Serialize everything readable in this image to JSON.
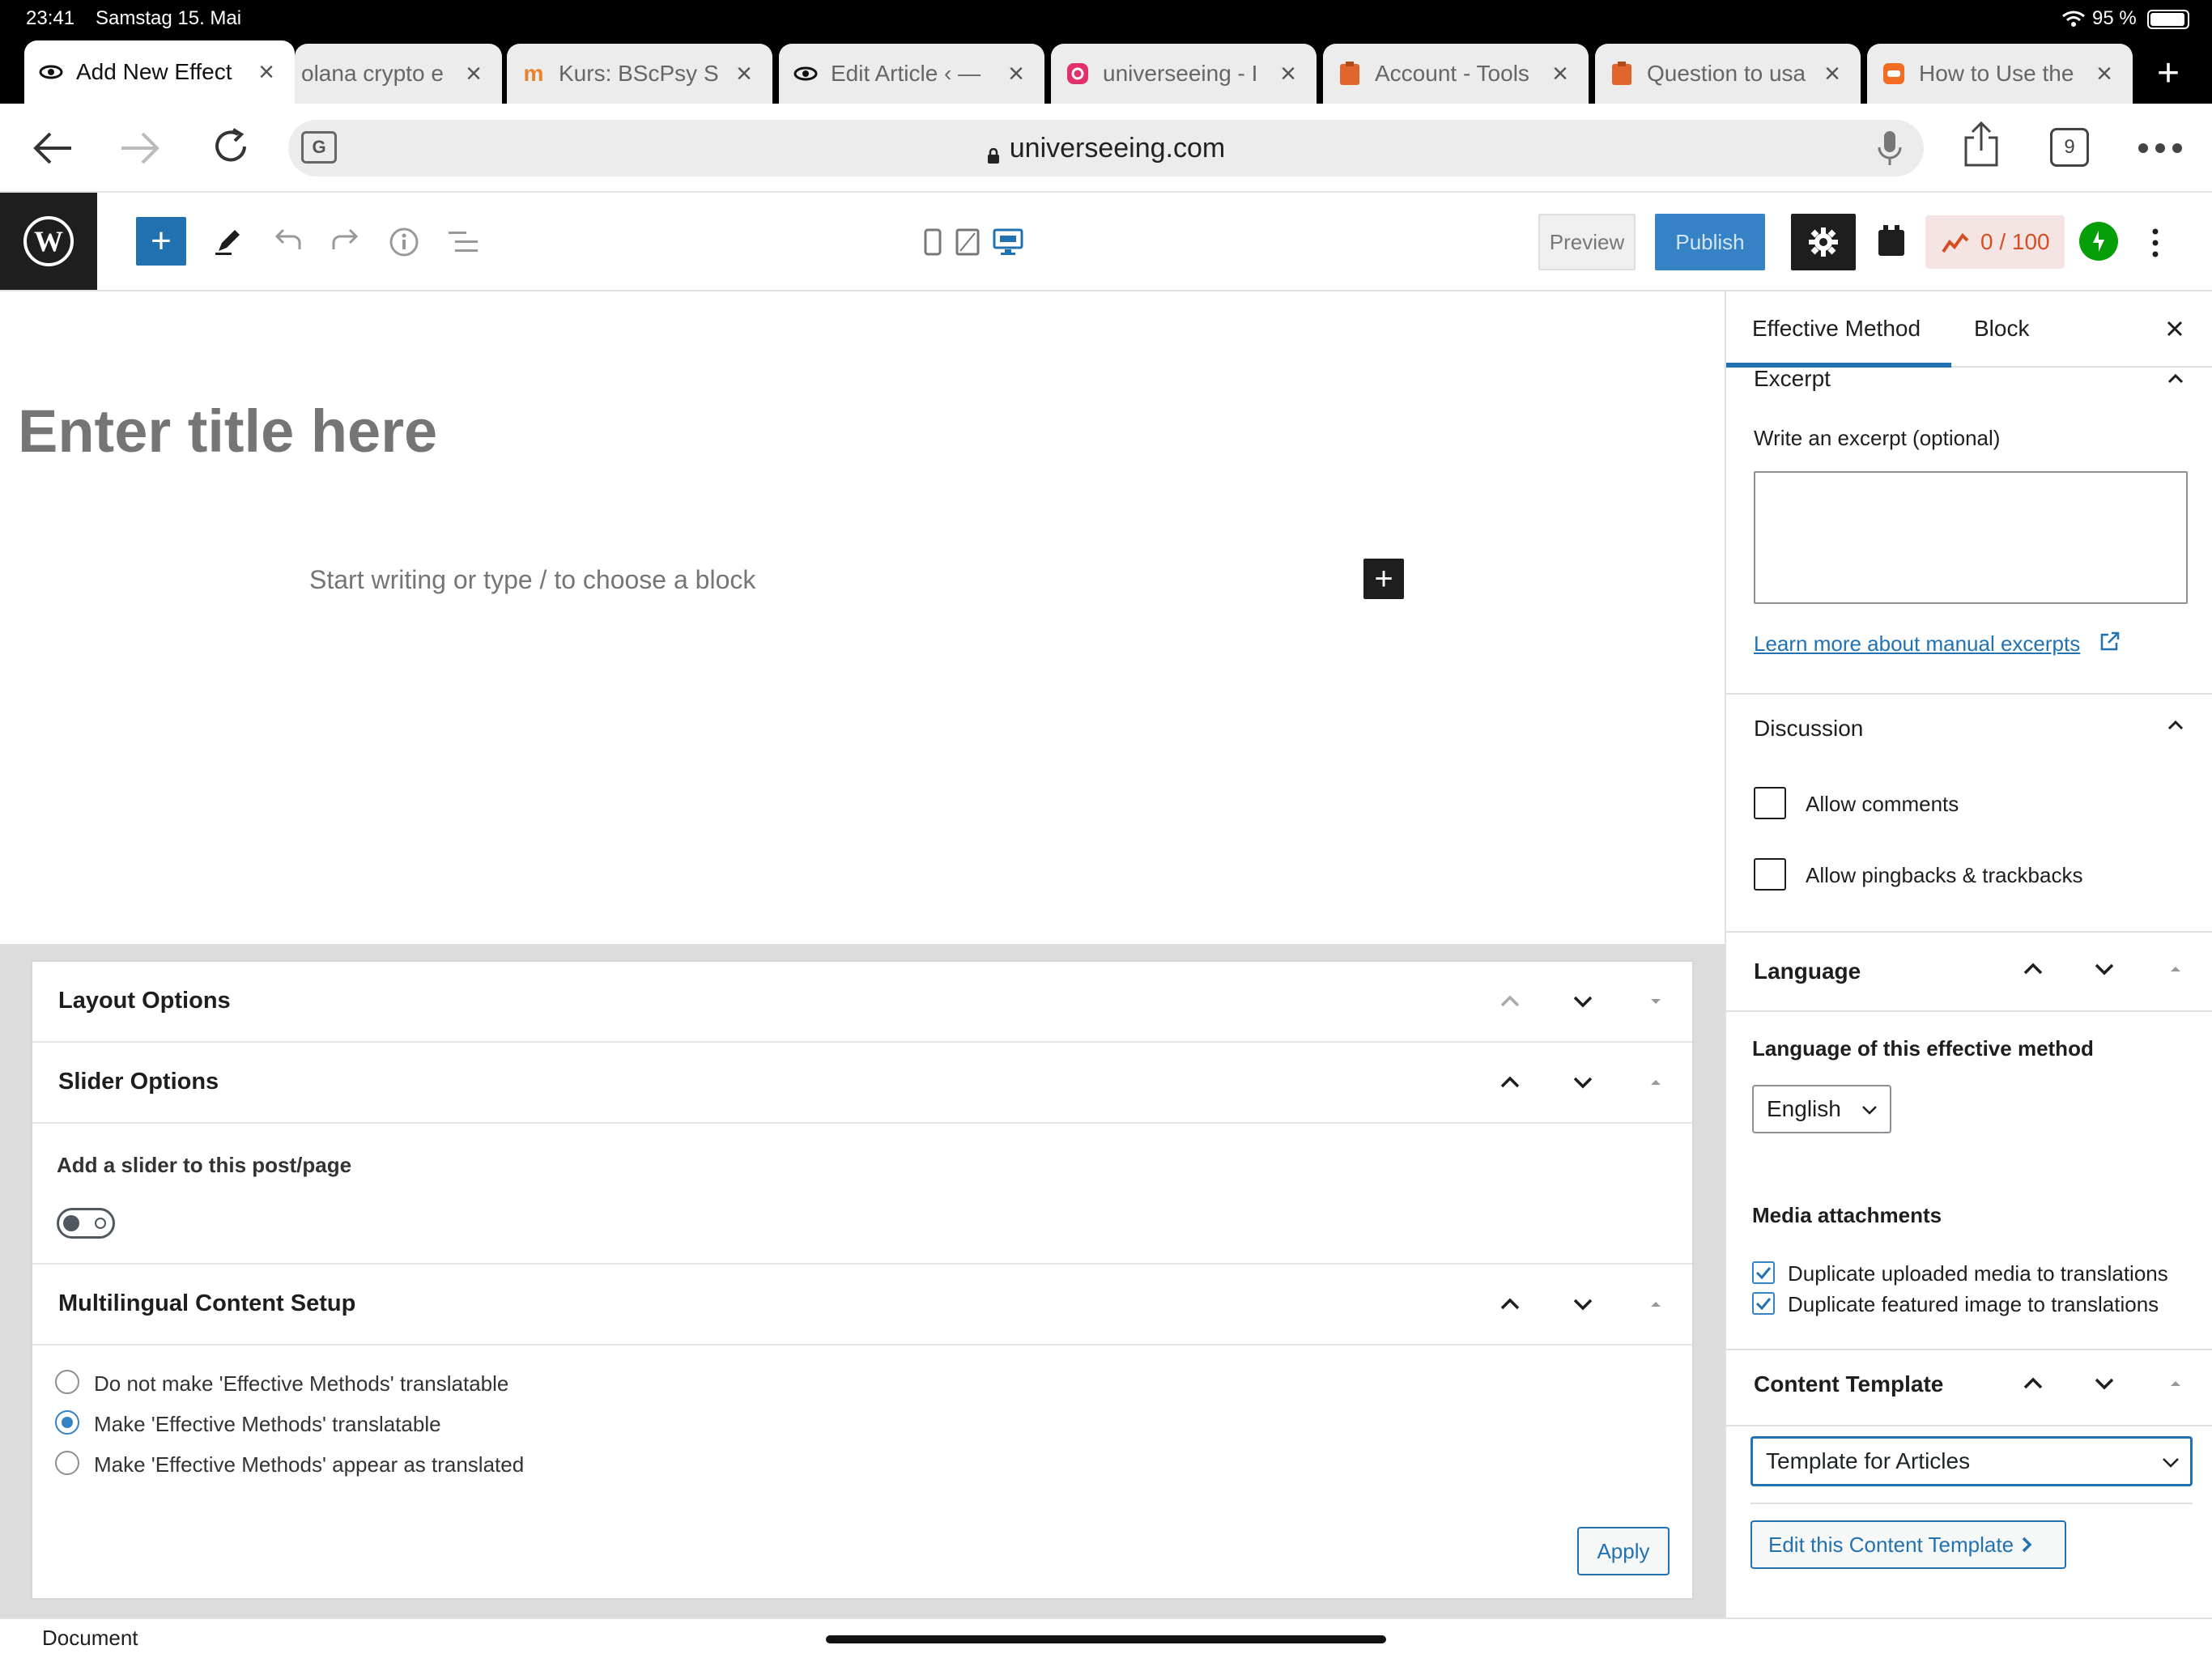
{
  "status_bar": {
    "time": "23:41",
    "date": "Samstag 15. Mai",
    "battery": "95 %"
  },
  "tabs": [
    {
      "title": "Add New Effect",
      "icon": "eye-icon"
    },
    {
      "title": "olana crypto e",
      "icon": ""
    },
    {
      "title": "Kurs: BScPsy S",
      "icon": "moodle-icon"
    },
    {
      "title": "Edit Article ‹ —",
      "icon": "eye-icon"
    },
    {
      "title": "universeeing - I",
      "icon": "instagram-icon"
    },
    {
      "title": "Account - Tools",
      "icon": "clipboard-icon"
    },
    {
      "title": "Question to usa",
      "icon": "clipboard-icon"
    },
    {
      "title": "How to Use the",
      "icon": "app-icon"
    }
  ],
  "browser": {
    "url": "universeeing.com",
    "tab_count": "9"
  },
  "wp_header": {
    "preview_label": "Preview",
    "publish_label": "Publish",
    "seo_score": "0 / 100"
  },
  "editor": {
    "title_placeholder": "Enter title here",
    "block_placeholder": "Start writing or type / to choose a block"
  },
  "metaboxes": {
    "layout_options": "Layout Options",
    "slider_options": "Slider Options",
    "slider_label": "Add a slider to this post/page",
    "multilingual": "Multilingual Content Setup",
    "radio_options": [
      "Do not make 'Effective Methods' translatable",
      "Make 'Effective Methods' translatable",
      "Make 'Effective Methods' appear as translated"
    ],
    "apply_label": "Apply"
  },
  "sidebar": {
    "tab_post": "Effective Method",
    "tab_block": "Block",
    "excerpt_title": "Excerpt",
    "excerpt_label": "Write an excerpt (optional)",
    "excerpt_link": "Learn more about manual excerpts",
    "discussion_title": "Discussion",
    "allow_comments": "Allow comments",
    "allow_pingbacks": "Allow pingbacks & trackbacks",
    "language_title": "Language",
    "language_label": "Language of this effective method",
    "language_value": "English",
    "media_title": "Media attachments",
    "media_dup_uploaded": "Duplicate uploaded media to translations",
    "media_dup_featured": "Duplicate featured image to translations",
    "template_title": "Content Template",
    "template_value": "Template for Articles",
    "edit_template": "Edit this Content Template"
  },
  "footer": {
    "breadcrumb": "Document"
  },
  "colors": {
    "accent": "#2271b1",
    "publish": "#3582c4",
    "seo": "#d54e21",
    "jetpack": "#069e08"
  }
}
